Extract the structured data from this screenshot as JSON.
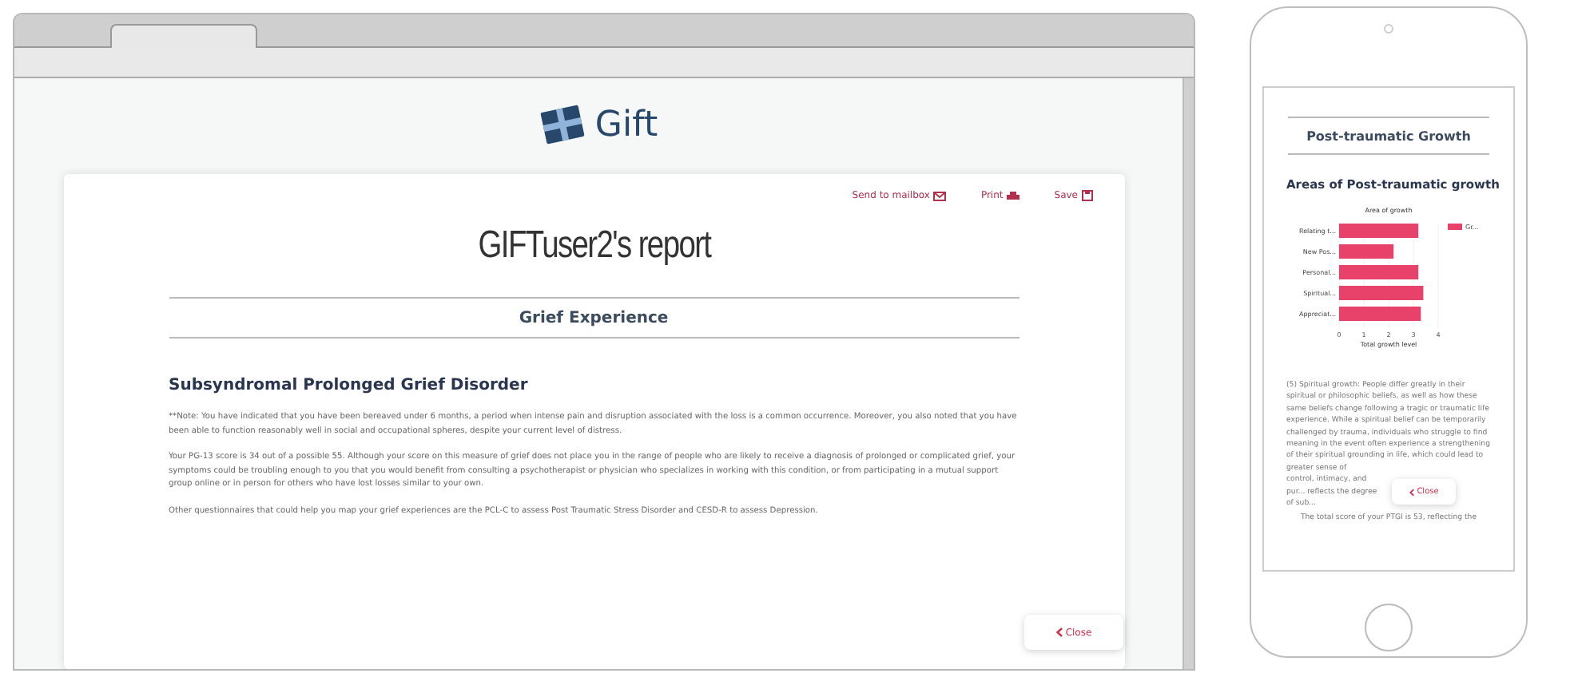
{
  "browser": {
    "logo": "Gift",
    "actions": [
      {
        "label": "Send to mailbox",
        "kind": "mail"
      },
      {
        "label": "Print",
        "kind": "print"
      },
      {
        "label": "Save",
        "kind": "save"
      }
    ],
    "report_title": "GIFTuser2's report",
    "section_title": "Grief Experience",
    "heading": "Subsyndromal Prolonged Grief Disorder",
    "paragraphs": [
      "**Note: You have indicated that you have been bereaved under 6 months, a period when intense pain and disruption associated with the loss is a common occurrence. Moreover, you also noted that you have been able to function reasonably well in social and occupational spheres, despite your current level of distress.",
      "Your PG-13 score is 34 out of a possible 55. Although your score on this measure of grief does not place you in the range of people who are likely to receive a diagnosis of prolonged or complicated grief, your symptoms could be troubling enough to you that you would benefit from consulting a psychotherapist or physician who specializes in working with this condition, or from participating in a mutual support group online or in person for others who have lost losses similar to your own.",
      "Other questionnaires that could help you map your grief experiences are the PCL-C to assess Post Traumatic Stress Disorder and CESD-R to assess Depression."
    ],
    "close": "Close"
  },
  "phone": {
    "section_title": "Post-traumatic Growth",
    "heading": "Areas of Post-traumatic growth",
    "chart_data": {
      "type": "bar",
      "orientation": "horizontal",
      "title": "Area of growth",
      "xlabel": "Total growth level",
      "categories": [
        "Relating t...",
        "New Pos...",
        "Personal...",
        "Spiritual...",
        "Appreciat..."
      ],
      "series": [
        {
          "name": "Gr...",
          "color": "#e8426b",
          "values": [
            3.2,
            2.2,
            3.2,
            3.4,
            3.3
          ]
        }
      ],
      "xlim": [
        0,
        4
      ],
      "xticks": [
        0,
        1,
        2,
        3,
        4
      ],
      "grid": true
    },
    "paragraph": "(5) Spiritual growth: People differ greatly in their spiritual or philosophic beliefs, as well as how these same beliefs change following a tragic or traumatic life experience. While a spiritual belief can be temporarily challenged by trauma, individuals who struggle to find meaning in the event often experience a strengthening of their spiritual grounding in life, which could lead to greater sense of",
    "paragraph_end": "control, intimacy, and pur... reflects the degree of sub...",
    "last_line": "The total score of your PTGI is 53, reflecting the",
    "close": "Close"
  }
}
